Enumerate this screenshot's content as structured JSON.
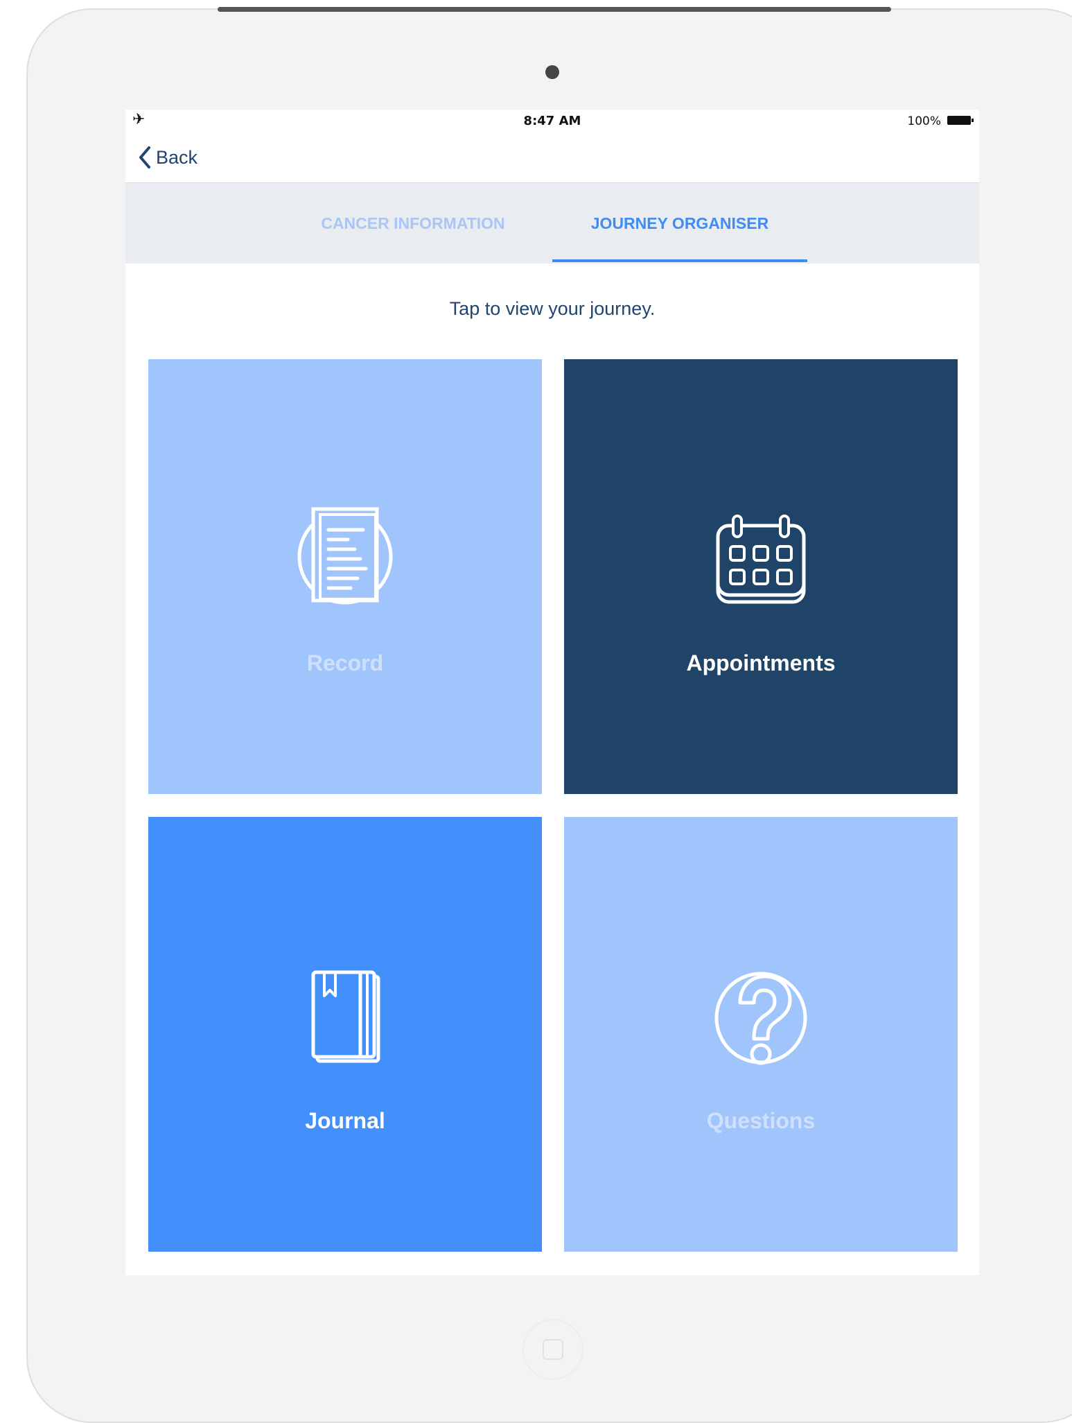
{
  "status_bar": {
    "time": "8:47 AM",
    "battery_percent": "100%",
    "airplane_icon": "airplane-icon",
    "battery_icon": "battery-icon"
  },
  "nav": {
    "back_label": "Back",
    "back_icon": "chevron-left-icon"
  },
  "tabs": [
    {
      "label": "CANCER INFORMATION",
      "active": false
    },
    {
      "label": "JOURNEY ORGANISER",
      "active": true
    }
  ],
  "subtitle": "Tap to view your journey.",
  "tiles": [
    {
      "label": "Record",
      "icon": "document-icon",
      "color": "#a0c5fd"
    },
    {
      "label": "Appointments",
      "icon": "calendar-icon",
      "color": "#1f4467"
    },
    {
      "label": "Journal",
      "icon": "book-icon",
      "color": "#438ffb"
    },
    {
      "label": "Questions",
      "icon": "question-icon",
      "color": "#a0c5fd"
    }
  ],
  "colors": {
    "accent": "#3f8cf7",
    "inactive_tab": "#a9c6f7",
    "navy": "#1f4470"
  }
}
